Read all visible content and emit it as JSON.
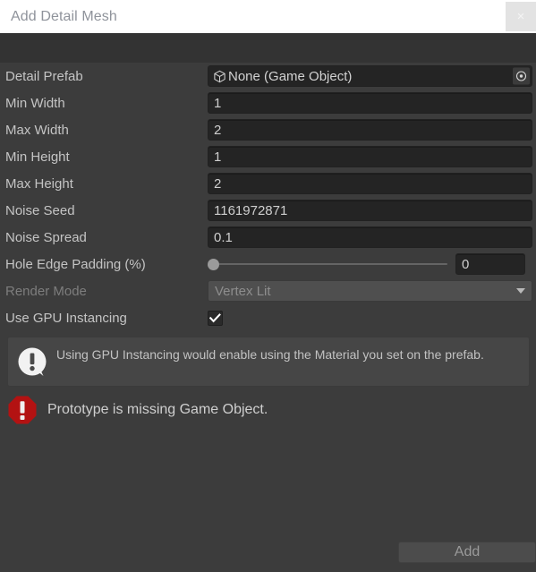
{
  "window": {
    "title": "Add Detail Mesh",
    "close_label": "×"
  },
  "form": {
    "detail_prefab": {
      "label": "Detail Prefab",
      "value": "None (Game Object)",
      "type_icon": "cube-icon",
      "picker_icon": "object-picker-icon"
    },
    "min_width": {
      "label": "Min Width",
      "value": "1"
    },
    "max_width": {
      "label": "Max Width",
      "value": "2"
    },
    "min_height": {
      "label": "Min Height",
      "value": "1"
    },
    "max_height": {
      "label": "Max Height",
      "value": "2"
    },
    "noise_seed": {
      "label": "Noise Seed",
      "value": "1161972871"
    },
    "noise_spread": {
      "label": "Noise Spread",
      "value": "0.1"
    },
    "hole_edge_padding": {
      "label": "Hole Edge Padding (%)",
      "value": "0",
      "slider_min": 0,
      "slider_max": 100,
      "slider_position_percent": 0
    },
    "render_mode": {
      "label": "Render Mode",
      "value": "Vertex Lit",
      "disabled": true,
      "arrow_icon": "chevron-down-icon"
    },
    "use_gpu_instancing": {
      "label": "Use GPU Instancing",
      "checked": true,
      "check_icon": "checkmark-icon"
    }
  },
  "help_box": {
    "icon": "info-bubble-icon",
    "text": "Using GPU Instancing would enable using the Material you set on the prefab."
  },
  "error": {
    "icon": "error-octagon-icon",
    "text": "Prototype is missing Game Object.",
    "color": "#b31212"
  },
  "footer": {
    "add_label": "Add",
    "add_disabled": true
  },
  "colors": {
    "window_background": "#3c3c3c",
    "titlebar_background": "#ffffff",
    "field_background": "#242424",
    "error_red": "#b31212",
    "label_text": "#c4c4c4",
    "disabled_text": "#7d7d7d"
  }
}
